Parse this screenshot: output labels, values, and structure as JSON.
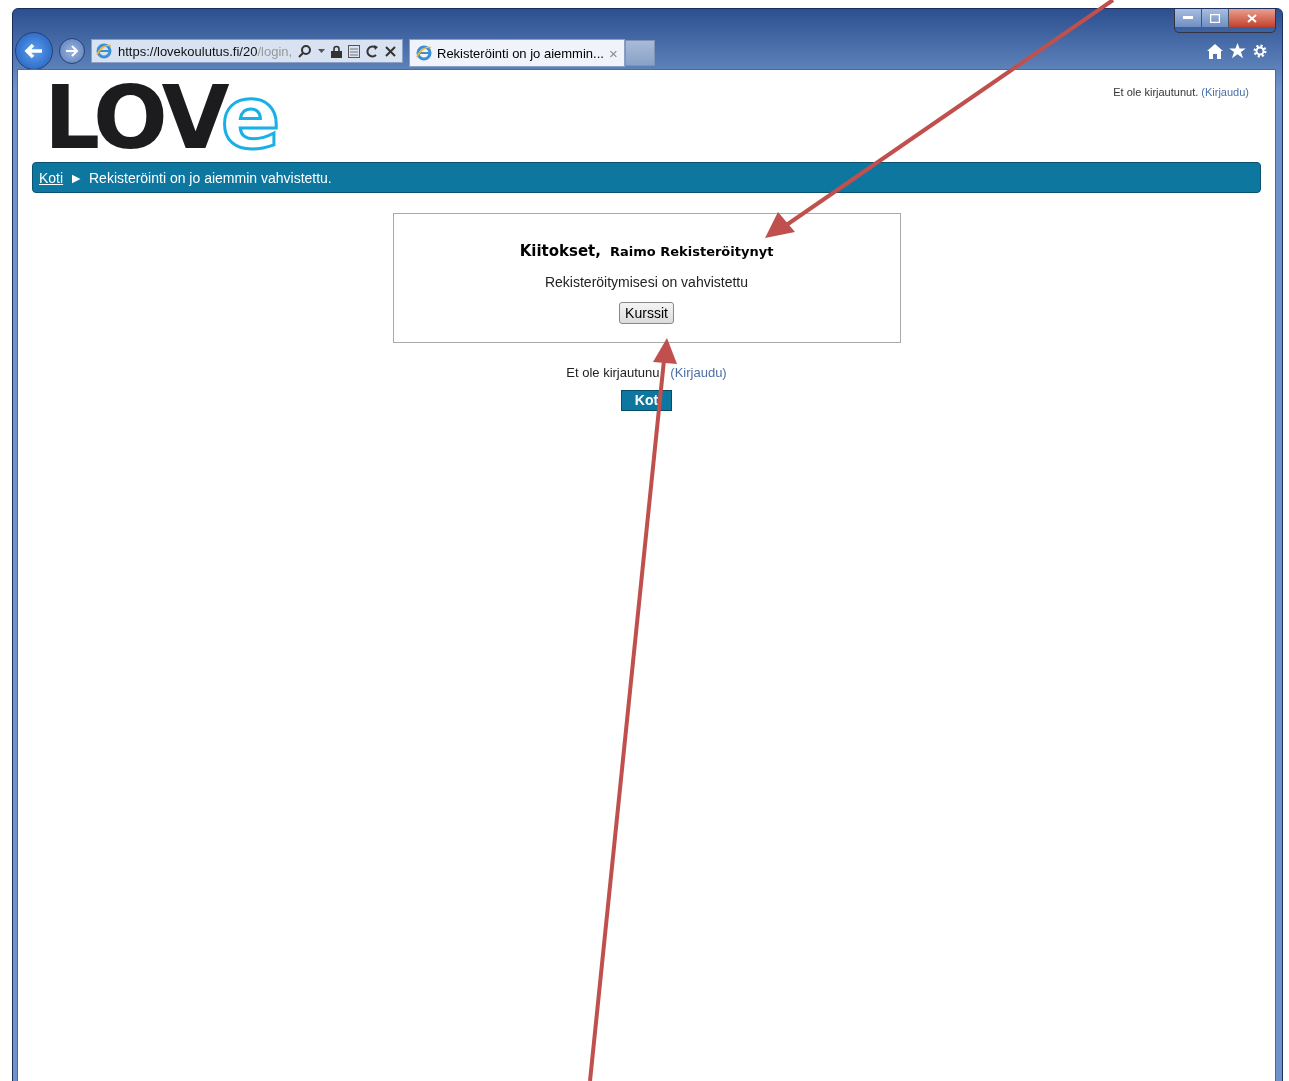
{
  "browser": {
    "url_host": "https://lovekoulutus.fi/20",
    "url_path": "/login,",
    "tabs": [
      {
        "title": "Rekisteröinti on jo aiemmin...",
        "close": "×",
        "selected": true
      }
    ]
  },
  "logo": {
    "dark": "LOV",
    "light": "e"
  },
  "header_login": {
    "text": "Et ole kirjautunut.",
    "link": "(Kirjaudu)"
  },
  "breadcrumb": {
    "home": "Koti",
    "separator": "►",
    "current": "Rekisteröinti on jo aiemmin vahvistettu."
  },
  "confirm_box": {
    "greeting": "Kiitokset,",
    "name": "Raimo Rekisteröitynyt",
    "message": "Rekisteröitymisesi on vahvistettu",
    "button": "Kurssit"
  },
  "footer_login": {
    "text": "Et ole kirjautunu",
    "link": "(Kirjaudu)"
  },
  "home_button": "Kot"
}
